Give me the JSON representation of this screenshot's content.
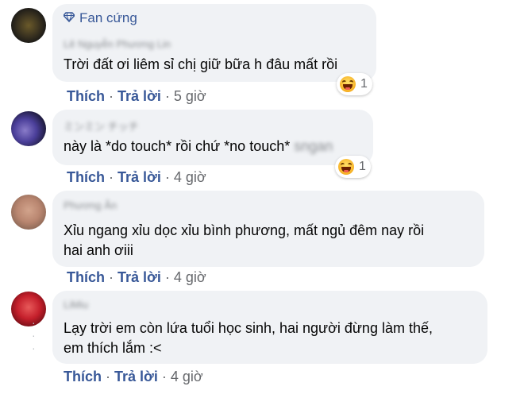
{
  "comments": [
    {
      "badge": "Fan cứng",
      "author": "Lê Nguyễn Phương Lin",
      "text_lines": [
        "Trời đất ơi liêm sỉ chị giữ bữa h đâu mất rồi"
      ],
      "text_tail": "",
      "reaction_count": "1",
      "like": "Thích",
      "reply": "Trả lời",
      "time": "5 giờ"
    },
    {
      "author": "ミンミン チッチ",
      "text_lines": [
        "này là *do touch* rồi chứ *no touch*"
      ],
      "text_tail": "sngan",
      "reaction_count": "1",
      "like": "Thích",
      "reply": "Trả lời",
      "time": "4 giờ"
    },
    {
      "author": "Phương Ân",
      "text_lines": [
        "Xỉu ngang xỉu dọc xỉu bình phương, mất ngủ đêm nay rồi",
        "hai anh ơiii"
      ],
      "like": "Thích",
      "reply": "Trả lời",
      "time": "4 giờ"
    },
    {
      "author": "LiMiu",
      "text_lines": [
        "Lạy trời em còn lứa tuổi học sinh, hai người đừng làm thế,",
        "em thích lắm :<"
      ],
      "like": "Thích",
      "reply": "Trả lời",
      "time": "4 giờ"
    }
  ],
  "colors": {
    "bubble": "#f0f2f5",
    "link": "#385898",
    "muted": "#65676b",
    "text": "#050505"
  }
}
